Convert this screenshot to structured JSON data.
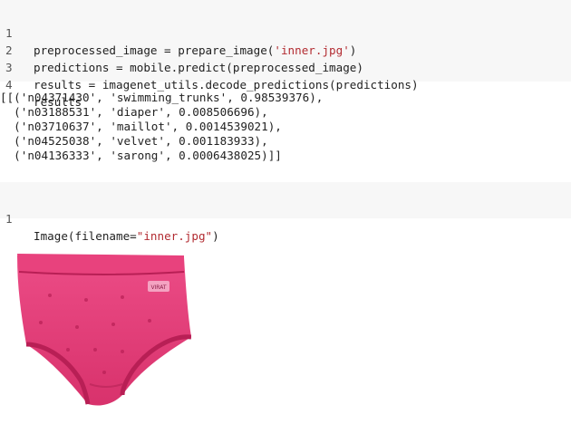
{
  "cell1": {
    "lines": [
      {
        "no": "1",
        "pre": "preprocessed_image = prepare_image(",
        "str": "'inner.jpg'",
        "post": ")"
      },
      {
        "no": "2",
        "pre": "predictions = mobile.predict(preprocessed_image)",
        "str": "",
        "post": ""
      },
      {
        "no": "3",
        "pre": "results = imagenet_utils.decode_predictions(predictions)",
        "str": "",
        "post": ""
      },
      {
        "no": "4",
        "pre": "results",
        "str": "",
        "post": ""
      }
    ]
  },
  "output": {
    "lines": [
      "[[('n04371430', 'swimming_trunks', 0.98539376),",
      "  ('n03188531', 'diaper', 0.008506696),",
      "  ('n03710637', 'maillot', 0.0014539021),",
      "  ('n04525038', 'velvet', 0.001183933),",
      "  ('n04136333', 'sarong', 0.0006438025)]]"
    ]
  },
  "cell2": {
    "lines": [
      {
        "no": "1",
        "pre": "Image(filename=",
        "str": "\"inner.jpg\"",
        "post": ")"
      }
    ]
  },
  "image": {
    "subject": "pink underwear brief",
    "main_color": "#e23a78",
    "shadow_color": "#b81f55",
    "label_text": "VIRAT"
  }
}
